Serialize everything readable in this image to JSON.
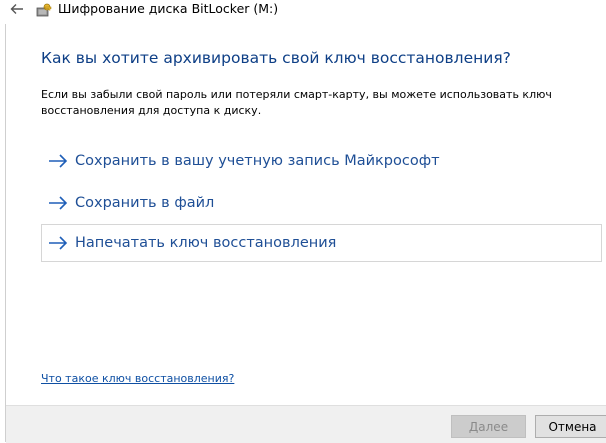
{
  "window": {
    "title": "Шифрование диска BitLocker (M:)"
  },
  "icons": {
    "back": "back-arrow-icon",
    "app": "bitlocker-key-icon",
    "option_arrow": "right-arrow-icon"
  },
  "main": {
    "heading": "Как вы хотите архивировать свой ключ восстановления?",
    "description": "Если вы забыли свой пароль или потеряли смарт-карту, вы можете использовать ключ восстановления для доступа к диску.",
    "options": [
      {
        "label": "Сохранить в вашу учетную запись Майкрософт",
        "hovered": false
      },
      {
        "label": "Сохранить в файл",
        "hovered": false
      },
      {
        "label": "Напечатать ключ восстановления",
        "hovered": true
      }
    ],
    "help_link": "Что такое ключ восстановления?"
  },
  "footer": {
    "next_label": "Далее",
    "next_enabled": false,
    "cancel_label": "Отмена"
  },
  "colors": {
    "heading": "#0e3f86",
    "option_text": "#1f4f96",
    "link": "#0e4fa3",
    "footer_bg": "#f0f0f0",
    "disabled_button_bg": "#cccccc"
  }
}
